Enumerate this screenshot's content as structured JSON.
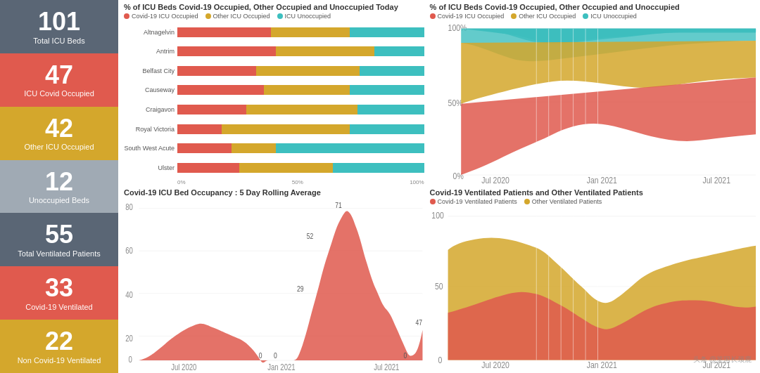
{
  "sidebar": {
    "cards": [
      {
        "number": "101",
        "label": "Total ICU Beds",
        "colorClass": "gray"
      },
      {
        "number": "47",
        "label": "ICU Covid Occupied",
        "colorClass": "red"
      },
      {
        "number": "42",
        "label": "Other ICU Occupied",
        "colorClass": "gold"
      },
      {
        "number": "12",
        "label": "Unoccupied Beds",
        "colorClass": "light-gray"
      },
      {
        "number": "55",
        "label": "Total Ventilated Patients",
        "colorClass": "gray2"
      },
      {
        "number": "33",
        "label": "Covid-19 Ventilated",
        "colorClass": "red2"
      },
      {
        "number": "22",
        "label": "Non Covid-19 Ventilated",
        "colorClass": "gold2"
      }
    ]
  },
  "topLeftChart": {
    "title": "% of ICU Beds Covid-19 Occupied, Other Occupied and Unoccupied Today",
    "legend": [
      {
        "label": "Covid-19 ICU Occupied",
        "color": "#e05a4e"
      },
      {
        "label": "Other ICU Occupied",
        "color": "#d4a72c"
      },
      {
        "label": "ICU Unoccupied",
        "color": "#3dbfbf"
      }
    ],
    "bars": [
      {
        "label": "Altnagelvin",
        "covid": 38,
        "other": 32,
        "unoccupied": 30
      },
      {
        "label": "Antrim",
        "covid": 40,
        "other": 40,
        "unoccupied": 20
      },
      {
        "label": "Belfast City",
        "covid": 32,
        "other": 42,
        "unoccupied": 26
      },
      {
        "label": "Causeway",
        "covid": 35,
        "other": 35,
        "unoccupied": 30
      },
      {
        "label": "Craigavon",
        "covid": 28,
        "other": 45,
        "unoccupied": 27
      },
      {
        "label": "Royal Victoria",
        "covid": 18,
        "other": 52,
        "unoccupied": 30
      },
      {
        "label": "South West Acute",
        "covid": 22,
        "other": 18,
        "unoccupied": 60
      },
      {
        "label": "Ulster",
        "covid": 25,
        "other": 38,
        "unoccupied": 37
      }
    ],
    "xLabels": [
      "0%",
      "50%",
      "100%"
    ]
  },
  "topRightChart": {
    "title": "% of ICU Beds Covid-19 Occupied, Other Occupied and Unoccupied",
    "legend": [
      {
        "label": "Covid-19 ICU Occupied",
        "color": "#e05a4e"
      },
      {
        "label": "Other ICU Occupied",
        "color": "#d4a72c"
      },
      {
        "label": "ICU Unoccupied",
        "color": "#3dbfbf"
      }
    ],
    "yLabels": [
      "100%",
      "50%",
      "0%"
    ],
    "xLabels": [
      "Jul 2020",
      "Jan 2021",
      "Jul 2021"
    ]
  },
  "bottomLeftChart": {
    "title": "Covid-19 ICU Bed Occupancy : 5 Day Rolling Average",
    "yLabels": [
      "80",
      "60",
      "40",
      "20",
      "0"
    ],
    "xLabels": [
      "Jul 2020",
      "Jan 2021",
      "Jul 2021"
    ],
    "peaks": [
      {
        "label": "71",
        "x": 0.44
      },
      {
        "label": "52",
        "x": 0.33
      },
      {
        "label": "29",
        "x": 0.41
      },
      {
        "label": "47",
        "x": 0.92
      },
      {
        "label": "0",
        "x": 0.25
      },
      {
        "label": "0",
        "x": 0.56
      },
      {
        "label": "0",
        "x": 0.82
      }
    ]
  },
  "bottomRightChart": {
    "title": "Covid-19 Ventilated Patients and Other Ventilated Patients",
    "legend": [
      {
        "label": "Covid-19 Ventilated Patients",
        "color": "#e05a4e"
      },
      {
        "label": "Other Ventilated Patients",
        "color": "#d4a72c"
      }
    ],
    "yLabels": [
      "100",
      "50",
      "0"
    ],
    "xLabels": [
      "Jul 2020",
      "Jan 2021",
      "Jul 2021"
    ]
  },
  "watermark": "头条 @英国长颈鹿"
}
